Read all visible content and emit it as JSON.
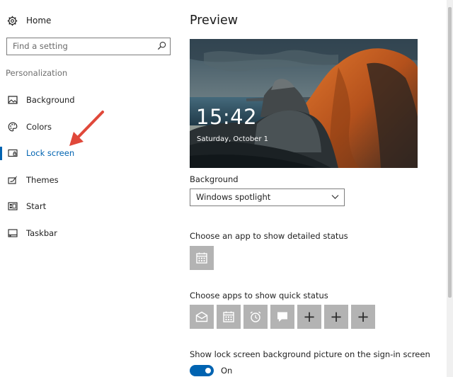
{
  "sidebar": {
    "home_label": "Home",
    "search_placeholder": "Find a setting",
    "section_label": "Personalization",
    "items": [
      {
        "label": "Background",
        "icon": "picture-icon"
      },
      {
        "label": "Colors",
        "icon": "palette-icon"
      },
      {
        "label": "Lock screen",
        "icon": "lock-screen-icon",
        "active": true
      },
      {
        "label": "Themes",
        "icon": "themes-icon"
      },
      {
        "label": "Start",
        "icon": "start-icon"
      },
      {
        "label": "Taskbar",
        "icon": "taskbar-icon"
      }
    ]
  },
  "main": {
    "title": "Preview",
    "preview": {
      "time": "15:42",
      "date": "Saturday, October 1"
    },
    "background_label": "Background",
    "background_value": "Windows spotlight",
    "detailed_status_label": "Choose an app to show detailed status",
    "quick_status_label": "Choose apps to show quick status",
    "quick_status_apps": [
      "mail-icon",
      "calendar-icon",
      "alarm-icon",
      "message-icon",
      "plus-icon",
      "plus-icon",
      "plus-icon"
    ],
    "plus_glyph": "+",
    "signin_label": "Show lock screen background picture on the sign-in screen",
    "signin_toggle": "On"
  },
  "colors": {
    "accent": "#0063b1",
    "tile": "#b3b3b3",
    "arrow": "#e0483a"
  }
}
